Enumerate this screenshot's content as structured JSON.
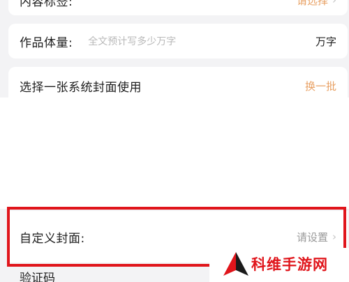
{
  "form": {
    "content_tags": {
      "label": "内容标签:",
      "value": "请选择",
      "chevron": "›"
    },
    "work_volume": {
      "label": "作品体量:",
      "placeholder": "全文预计写多少万字",
      "unit": "万字"
    },
    "system_cover": {
      "label": "选择一张系统封面使用",
      "action": "换一批"
    },
    "custom_cover": {
      "label": "自定义封面:",
      "value": "请设置",
      "chevron": "›"
    },
    "captcha": {
      "label": "验证码"
    }
  },
  "watermark": {
    "text": "科维手游网"
  },
  "colors": {
    "accent_orange": "#e8a063",
    "highlight_red": "#e0151b",
    "background": "#f3f3f5"
  }
}
